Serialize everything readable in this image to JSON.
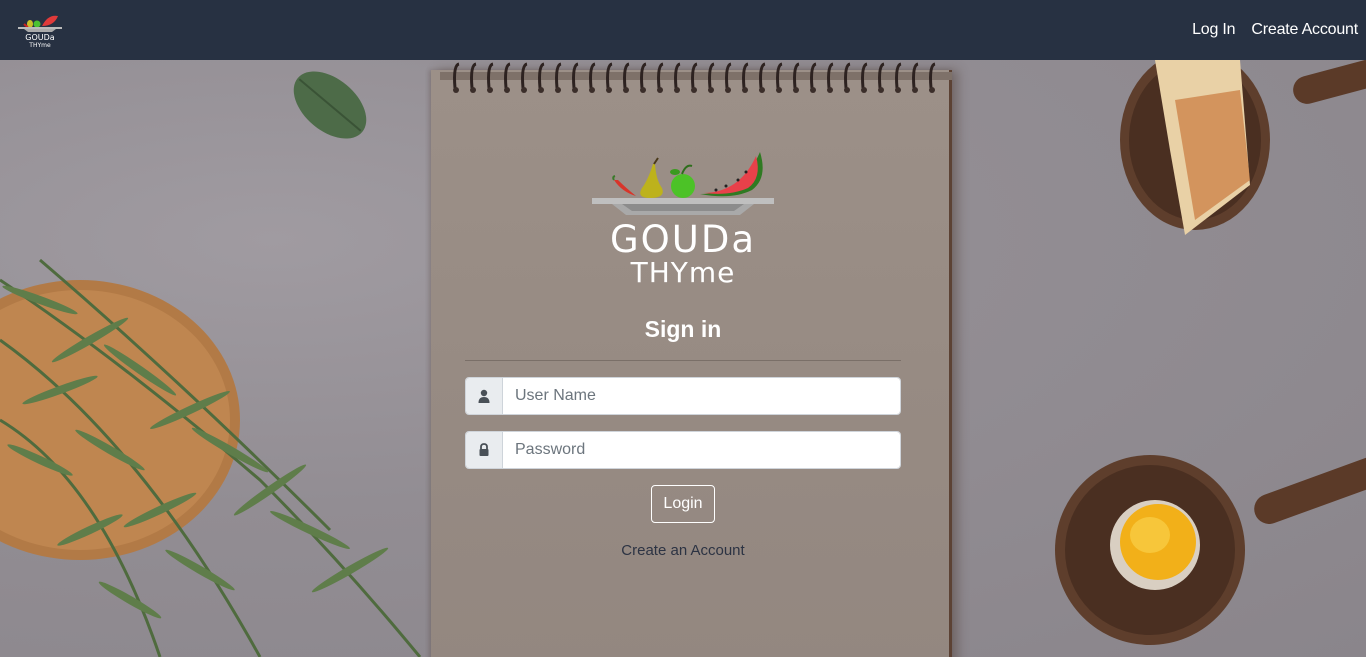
{
  "navbar": {
    "logo_icon": "gouda-thyme-logo",
    "links": [
      "Log In",
      "Create Account"
    ],
    "background": "#273142"
  },
  "logo": {
    "line1": "GOUDa",
    "line2": "THYme"
  },
  "signin": {
    "title": "Sign in",
    "username_placeholder": "User Name",
    "username_icon": "user-icon",
    "password_placeholder": "Password",
    "password_icon": "lock-icon",
    "login_label": "Login",
    "create_link": "Create an Account"
  }
}
